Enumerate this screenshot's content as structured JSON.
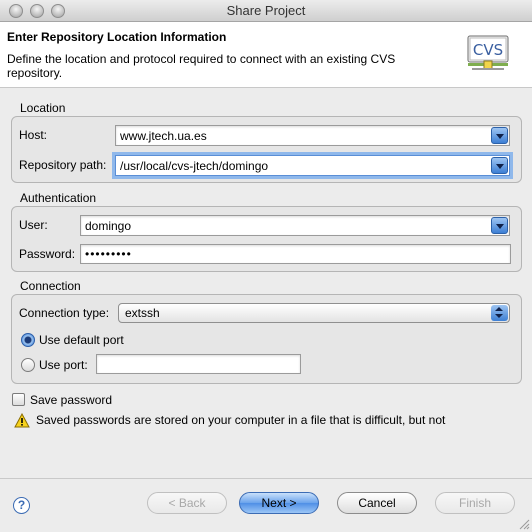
{
  "window": {
    "title": "Share Project"
  },
  "header": {
    "title": "Enter Repository Location Information",
    "description": "Define the location and protocol required to connect with an existing CVS repository.",
    "logo_text": "CVS"
  },
  "location": {
    "group_label": "Location",
    "host_label": "Host:",
    "host_value": "www.jtech.ua.es",
    "path_label": "Repository path:",
    "path_value": "/usr/local/cvs-jtech/domingo"
  },
  "authentication": {
    "group_label": "Authentication",
    "user_label": "User:",
    "user_value": "domingo",
    "password_label": "Password:",
    "password_value": "•••••••••"
  },
  "connection": {
    "group_label": "Connection",
    "type_label": "Connection type:",
    "type_value": "extssh",
    "default_port_label": "Use default port",
    "default_port_selected": true,
    "use_port_label": "Use port:",
    "port_value": ""
  },
  "save_password": {
    "label": "Save password",
    "checked": false,
    "warning": "Saved passwords are stored on your computer in a file that is difficult, but not"
  },
  "buttons": {
    "back": "< Back",
    "next": "Next >",
    "cancel": "Cancel",
    "finish": "Finish",
    "help": "?"
  },
  "icons": {
    "help": "help-icon",
    "warning": "warning-icon",
    "cvs_logo": "cvs-logo-icon"
  }
}
